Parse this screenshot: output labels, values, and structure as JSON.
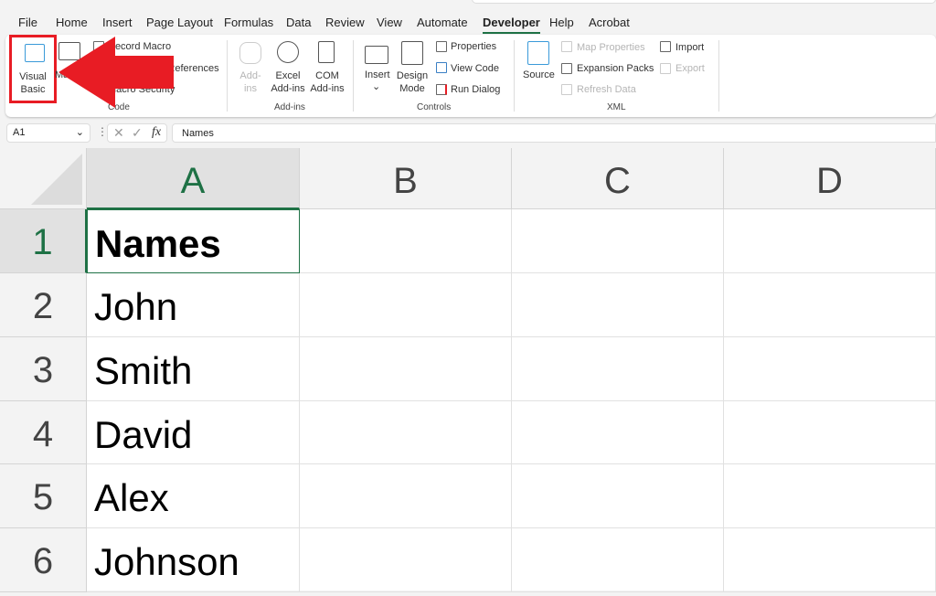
{
  "tabs": [
    "File",
    "Home",
    "Insert",
    "Page Layout",
    "Formulas",
    "Data",
    "Review",
    "View",
    "Automate",
    "Developer",
    "Help",
    "Acrobat"
  ],
  "active_tab": "Developer",
  "ribbon": {
    "code": {
      "visual_basic": [
        "Visual",
        "Basic"
      ],
      "macros": "Macros",
      "record_macro": "Record Macro",
      "relative_refs": "Use Relative References",
      "macro_security": "Macro Security",
      "group": "Code"
    },
    "addins": {
      "addins": [
        "Add-",
        "ins"
      ],
      "excel_addins": [
        "Excel",
        "Add-ins"
      ],
      "com_addins": [
        "COM",
        "Add-ins"
      ],
      "group": "Add-ins"
    },
    "controls": {
      "insert": "Insert",
      "design_mode": [
        "Design",
        "Mode"
      ],
      "properties": "Properties",
      "view_code": "View Code",
      "run_dialog": "Run Dialog",
      "group": "Controls"
    },
    "xml": {
      "source": "Source",
      "map_properties": "Map Properties",
      "expansion_packs": "Expansion Packs",
      "refresh_data": "Refresh Data",
      "import": "Import",
      "export": "Export",
      "group": "XML"
    }
  },
  "formula_bar": {
    "name_box": "A1",
    "fx": "fx",
    "value": "Names"
  },
  "columns": [
    "A",
    "B",
    "C",
    "D"
  ],
  "rows": [
    {
      "n": "1",
      "a": "Names"
    },
    {
      "n": "2",
      "a": "John"
    },
    {
      "n": "3",
      "a": "Smith"
    },
    {
      "n": "4",
      "a": "David"
    },
    {
      "n": "5",
      "a": "Alex"
    },
    {
      "n": "6",
      "a": "Johnson"
    }
  ],
  "colors": {
    "accent": "#1e7145",
    "highlight": "#e81c24"
  }
}
